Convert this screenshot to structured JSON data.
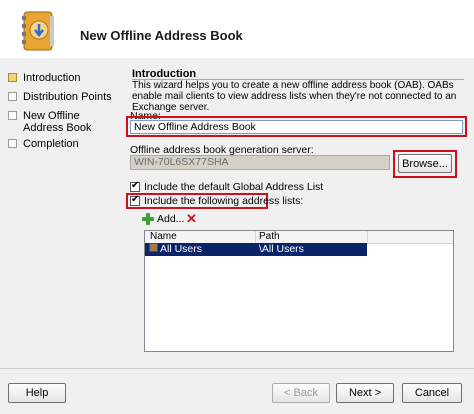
{
  "header": {
    "title": "New Offline Address Book"
  },
  "nav": {
    "items": [
      {
        "label": "Introduction",
        "active": true
      },
      {
        "label": "Distribution Points",
        "active": false
      },
      {
        "label": "New Offline Address Book",
        "active": false
      },
      {
        "label": "Completion",
        "active": false
      }
    ]
  },
  "intro": {
    "title": "Introduction",
    "description": "This wizard helps you to create a new offline address book (OAB). OABs enable mail clients to view address lists when they're not connected to an Exchange server."
  },
  "form": {
    "name_label": "Name:",
    "name_value": "New Offline Address Book",
    "server_label": "Offline address book generation server:",
    "server_value": "WIN-70L6SX77SHA",
    "browse_label": "Browse...",
    "include_gal_label": "Include the default Global Address List",
    "include_lists_label": "Include the following address lists:",
    "add_label": "Add...",
    "columns": {
      "name": "Name",
      "path": "Path"
    },
    "rows": [
      {
        "name": "All Users",
        "path": "\\All Users"
      }
    ]
  },
  "footer": {
    "help_label": "Help",
    "back_label": "< Back",
    "next_label": "Next >",
    "cancel_label": "Cancel"
  },
  "colors": {
    "highlight_red": "#d0101d",
    "selection_blue": "#0a246a"
  }
}
